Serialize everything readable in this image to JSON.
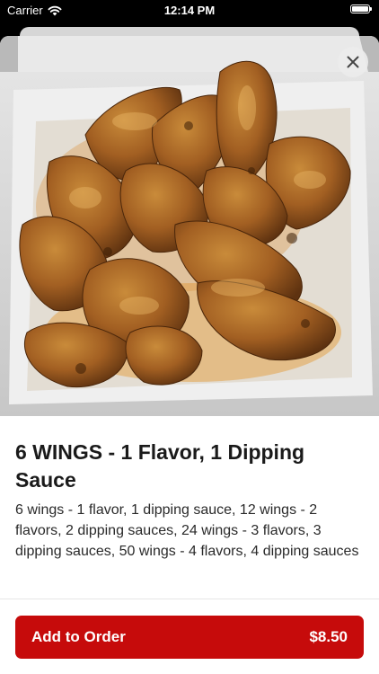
{
  "status_bar": {
    "carrier": "Carrier",
    "time": "12:14 PM"
  },
  "item": {
    "title": "6 WINGS - 1 Flavor, 1 Dipping Sauce",
    "description": "6 wings - 1 flavor, 1 dipping sauce, 12 wings - 2 flavors, 2 dipping sauces, 24 wings - 3 flavors, 3 dipping sauces, 50 wings - 4 flavors, 4 dipping sauces",
    "image_icon": "chicken-wings-photo"
  },
  "actions": {
    "close_icon": "close-icon",
    "add_label": "Add to Order",
    "price": "$8.50"
  },
  "colors": {
    "accent": "#c60b0b",
    "background": "#ffffff",
    "text": "#1a1a1a"
  }
}
